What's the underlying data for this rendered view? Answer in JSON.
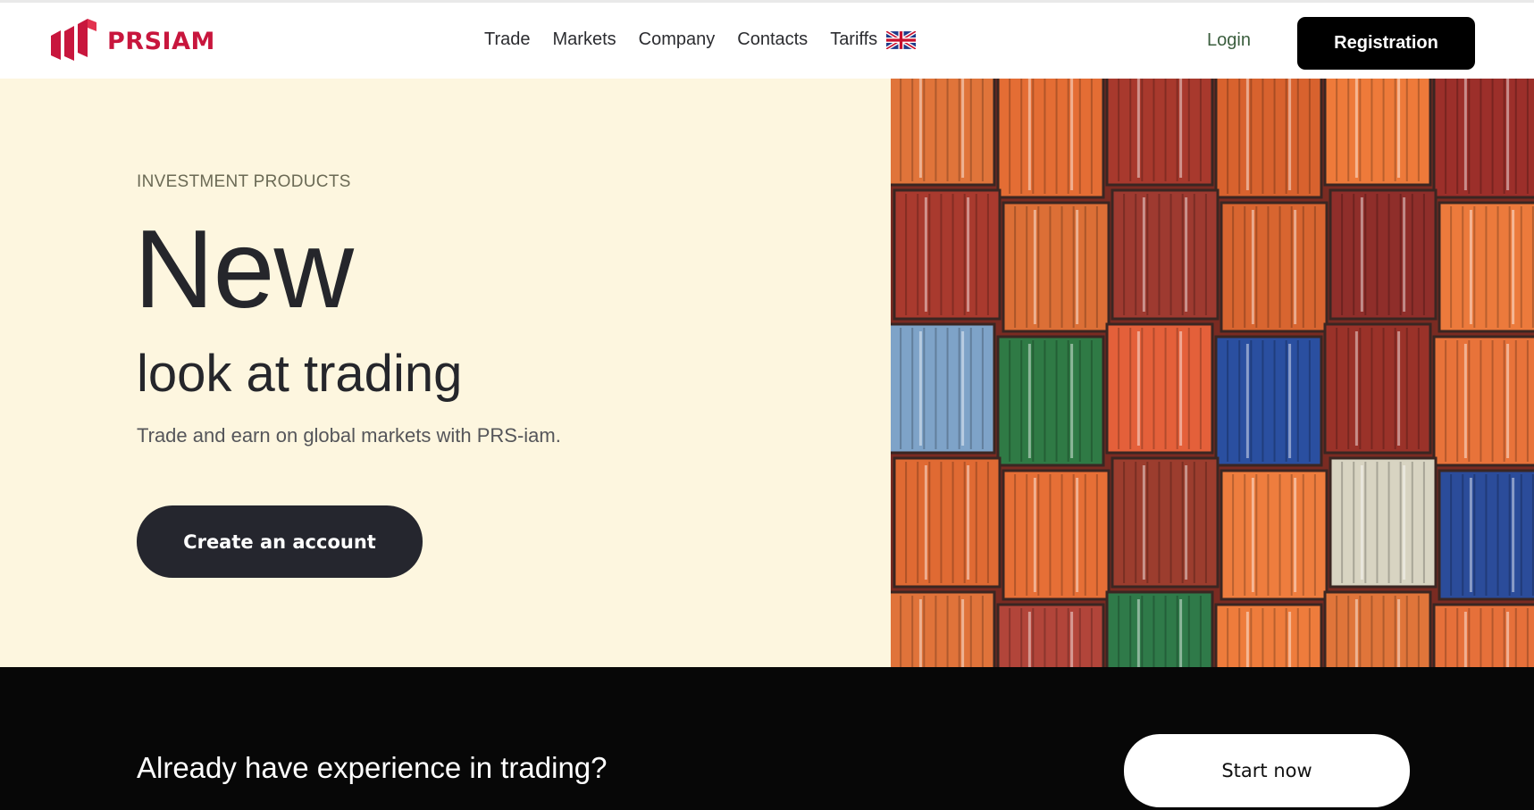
{
  "brand": {
    "name": "PRSIAM",
    "accent": "#c8163d"
  },
  "nav": {
    "items": [
      "Trade",
      "Markets",
      "Company",
      "Contacts",
      "Tariffs"
    ],
    "language_icon": "uk-flag-icon"
  },
  "header": {
    "login_label": "Login",
    "register_label": "Registration"
  },
  "hero": {
    "eyebrow": "INVESTMENT PRODUCTS",
    "headline": "New",
    "subheadline": "look at trading",
    "description": "Trade and earn on global markets with PRS-iam.",
    "cta_label": "Create an account",
    "background": "#fdf6df"
  },
  "band": {
    "title": "Already have experience in trading?",
    "cta_label": "Start now",
    "background": "#070707"
  }
}
